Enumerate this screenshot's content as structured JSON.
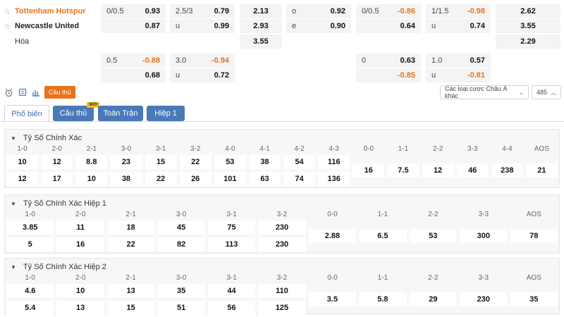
{
  "teams": {
    "home": "Tottenham Hotspur",
    "away": "Newcastle United",
    "draw": "Hòa",
    "star_icon": "star-outline-icon"
  },
  "odds": {
    "main": [
      {
        "col": "ah",
        "row": 0,
        "label": "0/0.5",
        "value": "0.93",
        "neg": false
      },
      {
        "col": "ah",
        "row": 1,
        "label": "",
        "value": "0.87",
        "neg": false
      },
      {
        "col": "ou",
        "row": 0,
        "label": "2.5/3",
        "value": "0.79",
        "neg": false
      },
      {
        "col": "ou",
        "row": 1,
        "label": "u",
        "value": "0.99",
        "neg": false
      },
      {
        "col": "x12",
        "row": 0,
        "label": "",
        "value": "2.13",
        "neg": false
      },
      {
        "col": "x12",
        "row": 1,
        "label": "",
        "value": "2.93",
        "neg": false
      },
      {
        "col": "x12",
        "row": 2,
        "label": "",
        "value": "3.55",
        "neg": false
      },
      {
        "col": "oe",
        "row": 0,
        "label": "o",
        "value": "0.92",
        "neg": false
      },
      {
        "col": "oe",
        "row": 1,
        "label": "e",
        "value": "0.90",
        "neg": false
      },
      {
        "col": "ah1",
        "row": 0,
        "label": "0/0.5",
        "value": "-0.86",
        "neg": true
      },
      {
        "col": "ah1",
        "row": 1,
        "label": "",
        "value": "0.64",
        "neg": false
      },
      {
        "col": "ou1",
        "row": 0,
        "label": "1/1.5",
        "value": "-0.98",
        "neg": true
      },
      {
        "col": "ou1",
        "row": 1,
        "label": "u",
        "value": "0.74",
        "neg": false
      },
      {
        "col": "x121",
        "row": 0,
        "label": "",
        "value": "2.62",
        "neg": false
      },
      {
        "col": "x121",
        "row": 1,
        "label": "",
        "value": "3.55",
        "neg": false
      },
      {
        "col": "x121",
        "row": 2,
        "label": "",
        "value": "2.29",
        "neg": false
      }
    ],
    "alt": [
      {
        "col": "ah",
        "row": 0,
        "label": "0.5",
        "value": "-0.88",
        "neg": true
      },
      {
        "col": "ah",
        "row": 1,
        "label": "",
        "value": "0.68",
        "neg": false
      },
      {
        "col": "ou",
        "row": 0,
        "label": "3.0",
        "value": "-0.94",
        "neg": true
      },
      {
        "col": "ou",
        "row": 1,
        "label": "u",
        "value": "0.72",
        "neg": false
      },
      {
        "col": "ah1",
        "row": 0,
        "label": "0",
        "value": "0.63",
        "neg": false
      },
      {
        "col": "ah1",
        "row": 1,
        "label": "",
        "value": "-0.85",
        "neg": true
      },
      {
        "col": "ou1",
        "row": 0,
        "label": "1.0",
        "value": "0.57",
        "neg": false
      },
      {
        "col": "ou1",
        "row": 1,
        "label": "u",
        "value": "-0.81",
        "neg": true
      }
    ]
  },
  "toolbar": {
    "icons": [
      "alarm-clock-icon",
      "list-icon",
      "bar-chart-icon"
    ],
    "player_badge": "Cầu thủ",
    "market_select": "Các loại cược Châu Á khác",
    "count_select": "485"
  },
  "tabs": [
    {
      "label": "Phổ biến",
      "active": true,
      "badge": ""
    },
    {
      "label": "Cầu thủ",
      "active": false,
      "badge": "MỚI"
    },
    {
      "label": "Toàn Trận",
      "active": false,
      "badge": ""
    },
    {
      "label": "Hiệp 1",
      "active": false,
      "badge": ""
    }
  ],
  "panels": [
    {
      "title": "Tỷ Số Chính Xác",
      "groups": [
        {
          "head": "1-0",
          "values": [
            "10",
            "12"
          ]
        },
        {
          "head": "2-0",
          "values": [
            "12",
            "17"
          ]
        },
        {
          "head": "2-1",
          "values": [
            "8.8",
            "10"
          ]
        },
        {
          "head": "3-0",
          "values": [
            "23",
            "38"
          ]
        },
        {
          "head": "3-1",
          "values": [
            "15",
            "22"
          ]
        },
        {
          "head": "3-2",
          "values": [
            "22",
            "26"
          ]
        },
        {
          "head": "4-0",
          "values": [
            "53",
            "101"
          ]
        },
        {
          "head": "4-1",
          "values": [
            "38",
            "63"
          ]
        },
        {
          "head": "4-2",
          "values": [
            "54",
            "74"
          ]
        },
        {
          "head": "4-3",
          "values": [
            "116",
            "136"
          ]
        },
        {
          "head": "0-0",
          "values": [
            "16"
          ]
        },
        {
          "head": "1-1",
          "values": [
            "7.5"
          ]
        },
        {
          "head": "2-2",
          "values": [
            "12"
          ]
        },
        {
          "head": "3-3",
          "values": [
            "46"
          ]
        },
        {
          "head": "4-4",
          "values": [
            "238"
          ]
        },
        {
          "head": "AOS",
          "values": [
            "21"
          ]
        }
      ]
    },
    {
      "title": "Tỷ Số Chính Xác Hiệp 1",
      "groups": [
        {
          "head": "1-0",
          "values": [
            "3.85",
            "5"
          ]
        },
        {
          "head": "2-0",
          "values": [
            "11",
            "16"
          ]
        },
        {
          "head": "2-1",
          "values": [
            "18",
            "22"
          ]
        },
        {
          "head": "3-0",
          "values": [
            "45",
            "82"
          ]
        },
        {
          "head": "3-1",
          "values": [
            "75",
            "113"
          ]
        },
        {
          "head": "3-2",
          "values": [
            "230",
            "230"
          ]
        },
        {
          "head": "0-0",
          "values": [
            "2.88"
          ]
        },
        {
          "head": "1-1",
          "values": [
            "6.5"
          ]
        },
        {
          "head": "2-2",
          "values": [
            "53"
          ]
        },
        {
          "head": "3-3",
          "values": [
            "300"
          ]
        },
        {
          "head": "AOS",
          "values": [
            "78"
          ]
        }
      ]
    },
    {
      "title": "Tỷ Số Chính Xác Hiệp 2",
      "groups": [
        {
          "head": "1-0",
          "values": [
            "4.6",
            "5.4"
          ]
        },
        {
          "head": "2-0",
          "values": [
            "10",
            "13"
          ]
        },
        {
          "head": "2-1",
          "values": [
            "13",
            "15"
          ]
        },
        {
          "head": "3-0",
          "values": [
            "35",
            "51"
          ]
        },
        {
          "head": "3-1",
          "values": [
            "44",
            "56"
          ]
        },
        {
          "head": "3-2",
          "values": [
            "110",
            "125"
          ]
        },
        {
          "head": "0-0",
          "values": [
            "3.5"
          ]
        },
        {
          "head": "1-1",
          "values": [
            "5.8"
          ]
        },
        {
          "head": "2-2",
          "values": [
            "29"
          ]
        },
        {
          "head": "3-3",
          "values": [
            "230"
          ]
        },
        {
          "head": "AOS",
          "values": [
            "35"
          ]
        }
      ]
    }
  ],
  "colors": {
    "accent": "#e8731c",
    "tab_blue": "#4a79b8",
    "negative": "#e8731c"
  }
}
